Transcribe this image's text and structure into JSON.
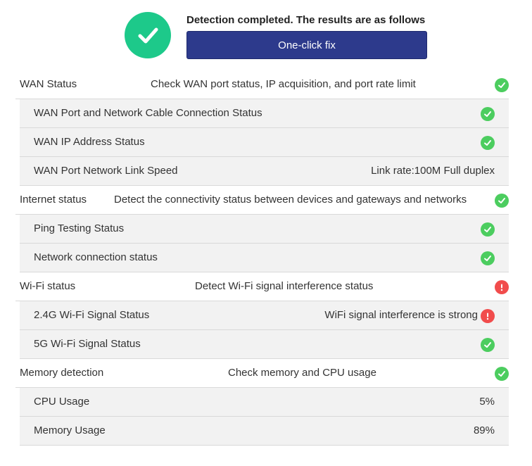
{
  "header": {
    "title": "Detection completed. The results are as follows",
    "fix_button": "One-click fix",
    "status_icon": "check-icon"
  },
  "sections": {
    "wan": {
      "label": "WAN Status",
      "description": "Check WAN port status, IP acquisition, and port rate limit",
      "status": "ok",
      "items": [
        {
          "label": "WAN Port and Network Cable Connection Status",
          "status": "ok"
        },
        {
          "label": "WAN IP Address Status",
          "status": "ok"
        },
        {
          "label": "WAN Port Network Link Speed",
          "value": "Link rate:100M Full duplex"
        }
      ]
    },
    "internet": {
      "label": "Internet status",
      "description": "Detect the connectivity status between devices and gateways and networks",
      "status": "ok",
      "items": [
        {
          "label": "Ping Testing Status",
          "status": "ok"
        },
        {
          "label": "Network connection status",
          "status": "ok"
        }
      ]
    },
    "wifi": {
      "label": "Wi-Fi status",
      "description": "Detect Wi-Fi signal interference status",
      "status": "warning",
      "items": [
        {
          "label": "2.4G Wi-Fi Signal Status",
          "value": "WiFi signal interference is strong",
          "status": "warning"
        },
        {
          "label": "5G Wi-Fi Signal Status",
          "status": "ok"
        }
      ]
    },
    "memory": {
      "label": "Memory detection",
      "description": "Check memory and CPU usage",
      "status": "ok",
      "items": [
        {
          "label": "CPU Usage",
          "value": "5%"
        },
        {
          "label": "Memory Usage",
          "value": "89%"
        }
      ]
    }
  },
  "colors": {
    "success": "#4ccd5f",
    "header_success": "#1dc98a",
    "warning": "#f14c4c",
    "button": "#2d3a8c"
  }
}
